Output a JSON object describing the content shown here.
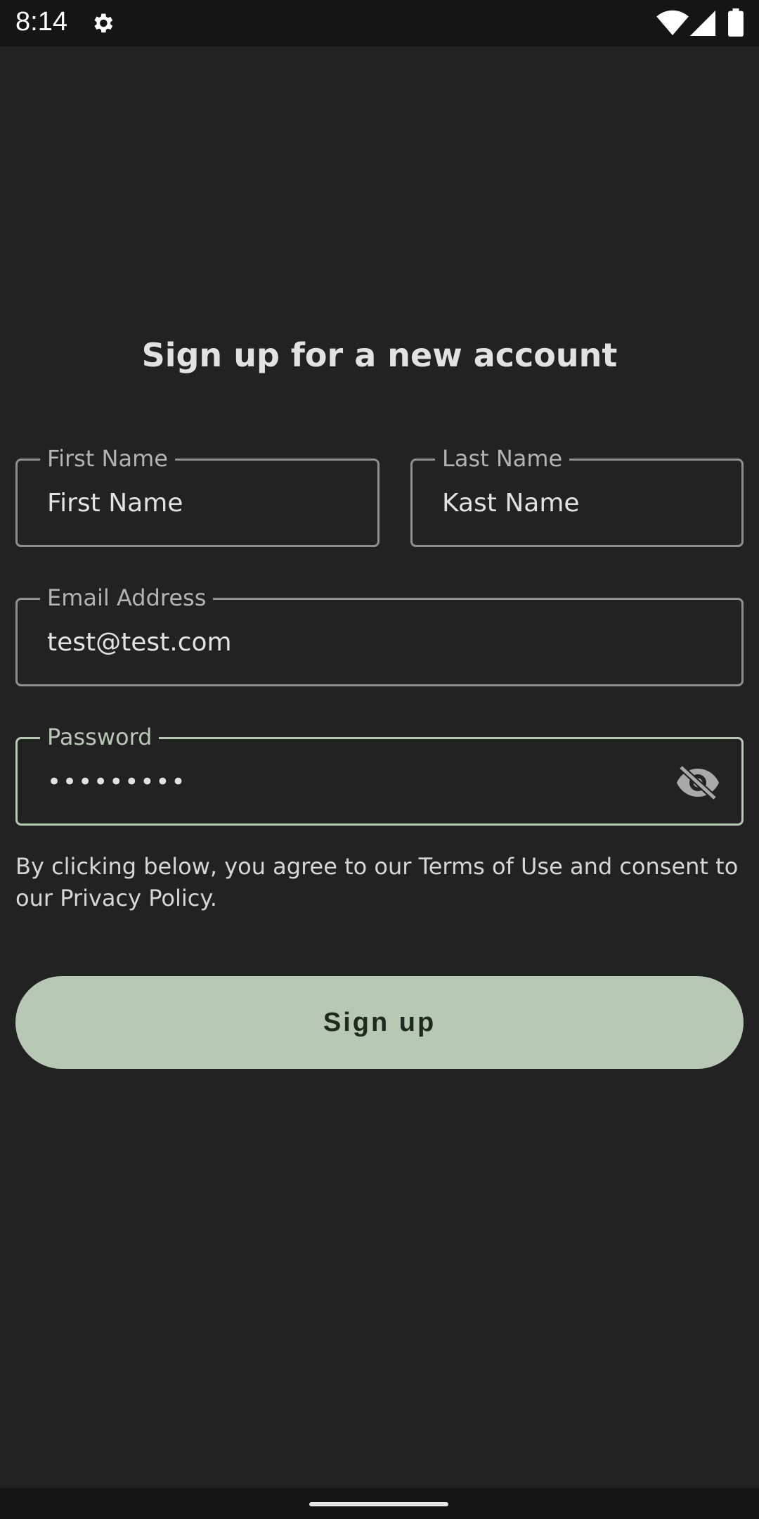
{
  "status_bar": {
    "time": "8:14",
    "icons": [
      "settings-icon",
      "wifi-icon",
      "cellular-signal-icon",
      "battery-icon"
    ]
  },
  "form": {
    "title": "Sign up for a new account",
    "first_name": {
      "label": "First Name",
      "value": "First Name"
    },
    "last_name": {
      "label": "Last Name",
      "value": "Kast Name"
    },
    "email": {
      "label": "Email Address",
      "value": "test@test.com"
    },
    "password": {
      "label": "Password",
      "value": "•••••••••",
      "toggle_icon": "visibility-off-icon"
    },
    "terms_text": "By clicking below, you agree to our Terms of Use and consent to our Privacy Policy.",
    "submit_label": "Sign up"
  },
  "colors": {
    "background": "#222222",
    "accent": "#b7c8b5",
    "field_border": "#8f8f8f"
  }
}
